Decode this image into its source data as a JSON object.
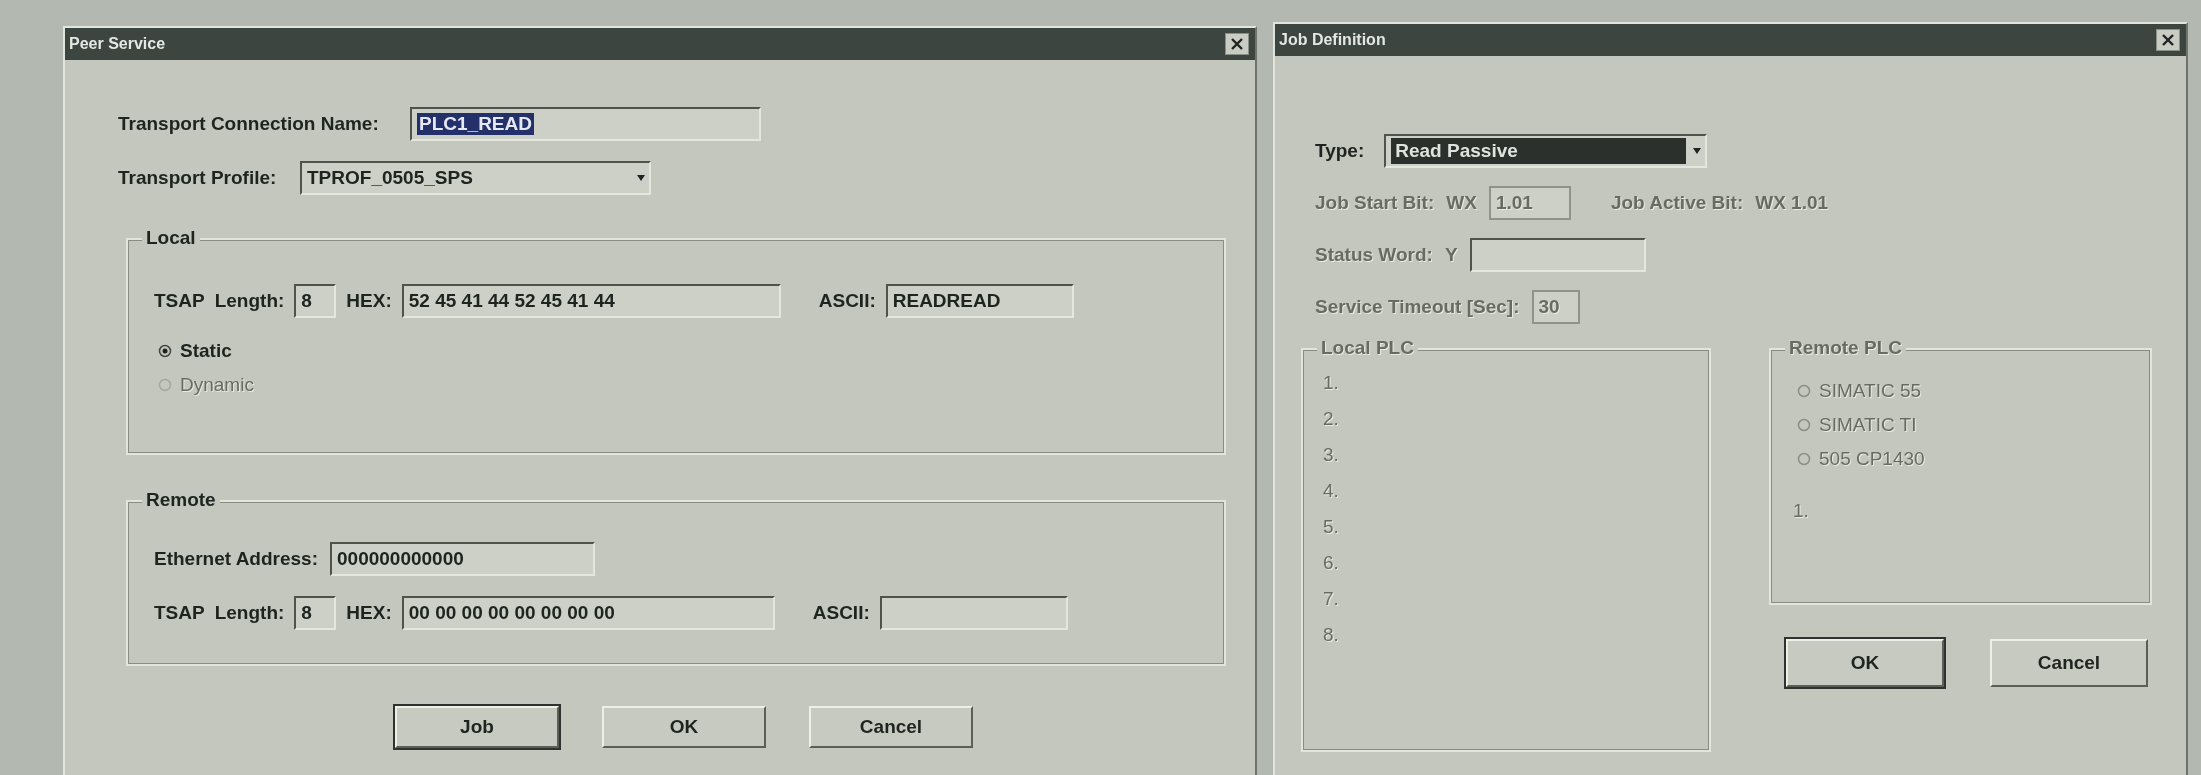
{
  "peer_service": {
    "title": "Peer Service",
    "connection_name": {
      "label": "Transport Connection Name:",
      "value": "PLC1_READ",
      "highlighted": true
    },
    "transport_profile": {
      "label": "Transport Profile:",
      "value": "TPROF_0505_SPS"
    },
    "local": {
      "title": "Local",
      "tsap_label": "TSAP",
      "length_label": "Length:",
      "length": "8",
      "hex_label": "HEX:",
      "hex": "52 45 41 44 52 45 41 44",
      "ascii_label": "ASCII:",
      "ascii": "READREAD",
      "modes": [
        {
          "label": "Static",
          "selected": true,
          "disabled": false
        },
        {
          "label": "Dynamic",
          "selected": false,
          "disabled": true
        }
      ]
    },
    "remote": {
      "title": "Remote",
      "ethernet_label": "Ethernet Address:",
      "ethernet": "000000000000",
      "tsap_label": "TSAP",
      "length_label": "Length:",
      "length": "8",
      "hex_label": "HEX:",
      "hex": "00 00 00 00 00 00 00 00",
      "ascii_label": "ASCII:"
    },
    "buttons": [
      {
        "label": "Job",
        "default": true
      },
      {
        "label": "OK",
        "default": false
      },
      {
        "label": "Cancel",
        "default": false
      }
    ]
  },
  "job_definition": {
    "title": "Job Definition",
    "type": {
      "label": "Type:",
      "value": "Read Passive",
      "highlighted": true
    },
    "job_start": {
      "label": "Job Start Bit:",
      "prefix": "WX",
      "value": "1.01",
      "disabled": true
    },
    "job_active": {
      "label": "Job Active Bit:",
      "value": "WX 1.01",
      "disabled": true
    },
    "status_word": {
      "label": "Status Word:",
      "prefix": "Y",
      "disabled": true
    },
    "service_timeout": {
      "label": "Service Timeout [Sec]:",
      "value": "30",
      "disabled": true
    },
    "local_plc": {
      "title": "Local PLC",
      "disabled": true,
      "items": [
        "1.",
        "2.",
        "3.",
        "4.",
        "5.",
        "6.",
        "7.",
        "8."
      ]
    },
    "remote_plc": {
      "title": "Remote PLC",
      "disabled": true,
      "options": [
        {
          "label": "SIMATIC 55",
          "selected": false
        },
        {
          "label": "SIMATIC TI",
          "selected": false
        },
        {
          "label": "505 CP1430",
          "selected": false
        }
      ],
      "entries": [
        "1."
      ]
    },
    "buttons": [
      {
        "label": "OK",
        "default": true
      },
      {
        "label": "Cancel",
        "default": false
      }
    ]
  }
}
